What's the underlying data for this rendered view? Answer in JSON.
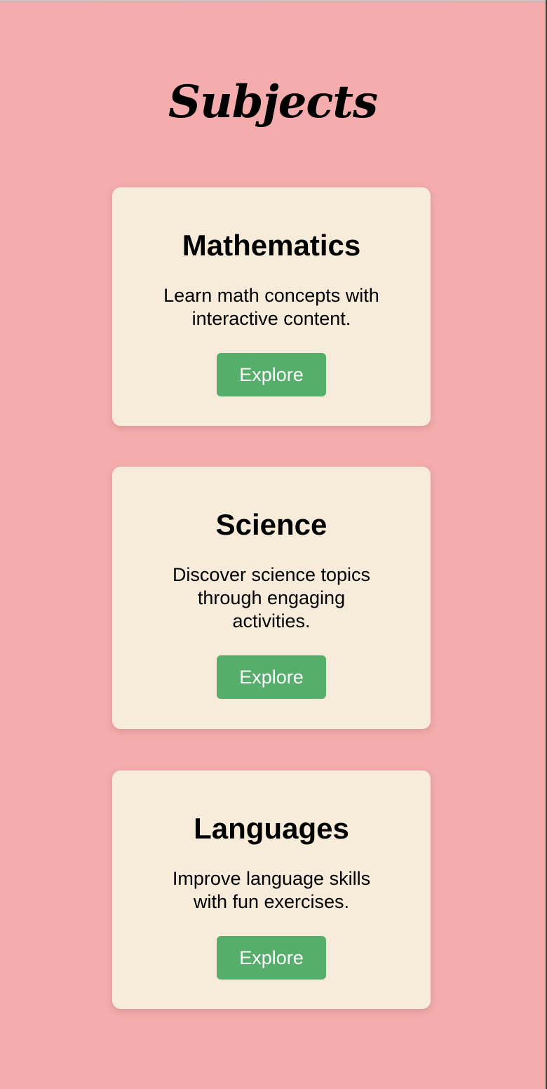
{
  "page": {
    "title": "Subjects"
  },
  "subjects": [
    {
      "title": "Mathematics",
      "description": "Learn math concepts with interactive content.",
      "button_label": "Explore"
    },
    {
      "title": "Science",
      "description": "Discover science topics through engaging activities.",
      "button_label": "Explore"
    },
    {
      "title": "Languages",
      "description": "Improve language skills with fun exercises.",
      "button_label": "Explore"
    }
  ],
  "colors": {
    "background": "#f4adac",
    "card": "#f7ebd9",
    "button": "#56ae6b",
    "button_text": "#ffffff"
  }
}
